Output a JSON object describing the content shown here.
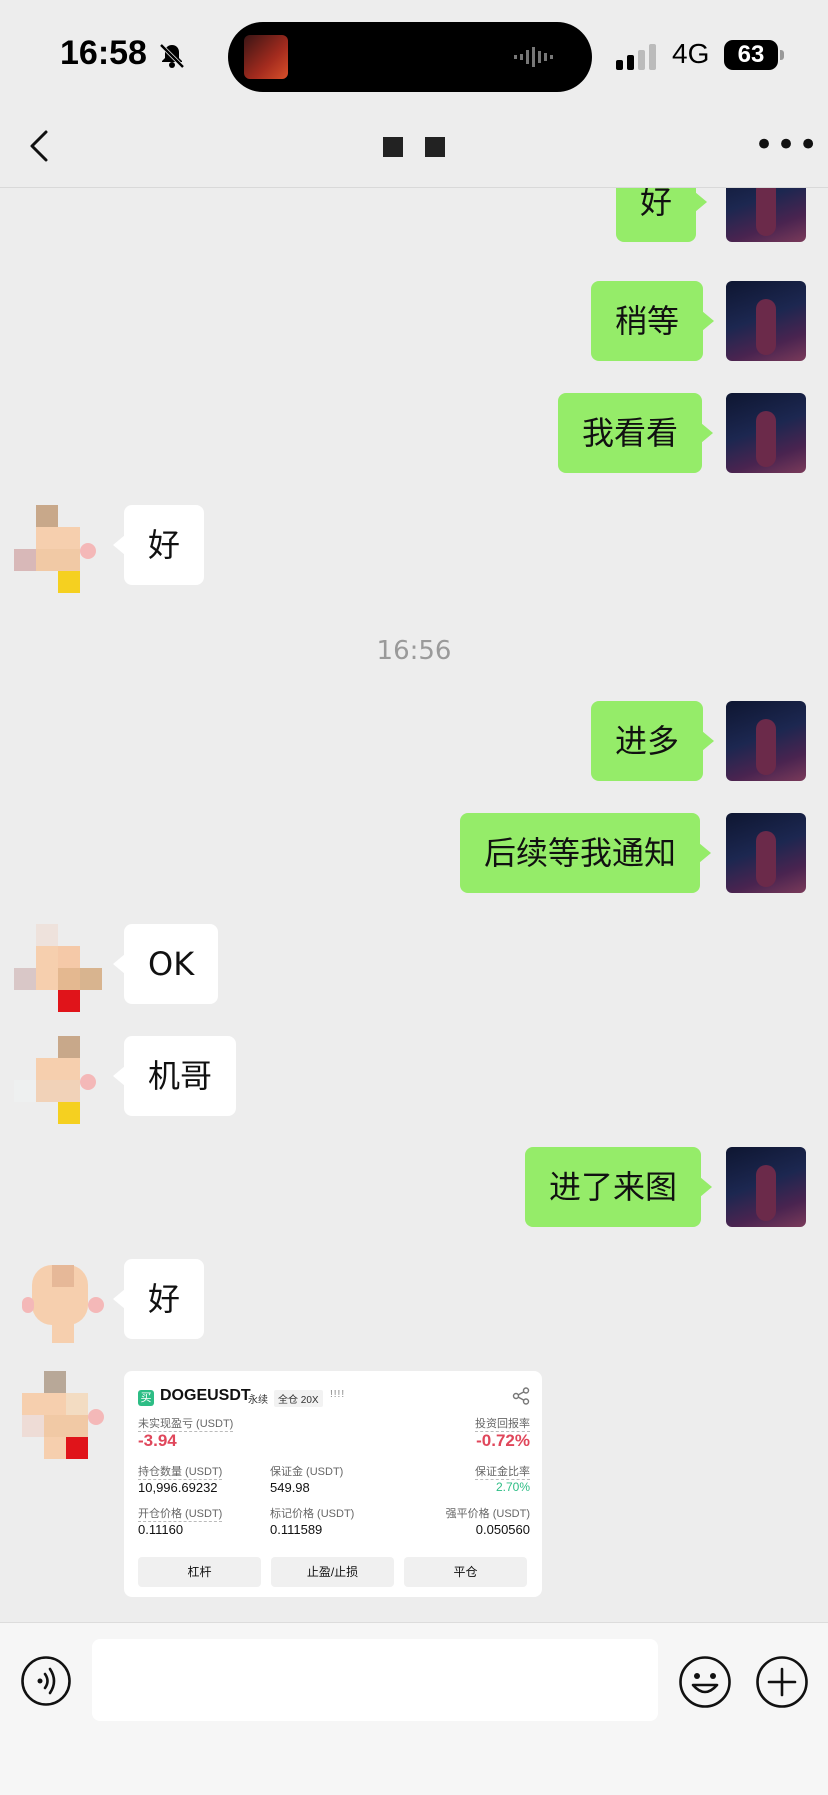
{
  "status_bar": {
    "time": "16:58",
    "network": "4G",
    "battery": "63"
  },
  "chat": {
    "title_hidden": true,
    "messages": [
      {
        "side": "me",
        "text": "好"
      },
      {
        "side": "me",
        "text": "稍等"
      },
      {
        "side": "me",
        "text": "我看看"
      },
      {
        "side": "other",
        "text": "好"
      },
      {
        "side": "time",
        "text": "16:56"
      },
      {
        "side": "me",
        "text": "进多"
      },
      {
        "side": "me",
        "text": "后续等我通知"
      },
      {
        "side": "other",
        "text": "OK"
      },
      {
        "side": "other",
        "text": "机哥"
      },
      {
        "side": "me",
        "text": "进了来图"
      },
      {
        "side": "other",
        "text": "好"
      }
    ]
  },
  "trade_card": {
    "logo": "买",
    "symbol": "DOGEUSDT",
    "tag_perp": "永续",
    "tag_margin": "全仓 20X",
    "bars": "!!!!",
    "unrealized_label": "未实现盈亏 (USDT)",
    "unrealized_value": "-3.94",
    "roe_label": "投资回报率",
    "roe_value": "-0.72%",
    "size_label": "持仓数量 (USDT)",
    "size_value": "10,996.69232",
    "margin_label": "保证金 (USDT)",
    "margin_value": "549.98",
    "margin_ratio_label": "保证金比率",
    "margin_ratio_value": "2.70%",
    "entry_label": "开仓价格 (USDT)",
    "entry_value": "0.11160",
    "mark_label": "标记价格 (USDT)",
    "mark_value": "0.111589",
    "liq_label": "强平价格 (USDT)",
    "liq_value": "0.050560",
    "btn_leverage": "杠杆",
    "btn_tpsl": "止盈/止损",
    "btn_close": "平仓"
  },
  "input_bar": {
    "placeholder": ""
  },
  "colors": {
    "bubble_me": "#95ec69",
    "bubble_other": "#ffffff",
    "loss": "#e0475b",
    "gain": "#2dbd85",
    "background": "#ededed"
  }
}
